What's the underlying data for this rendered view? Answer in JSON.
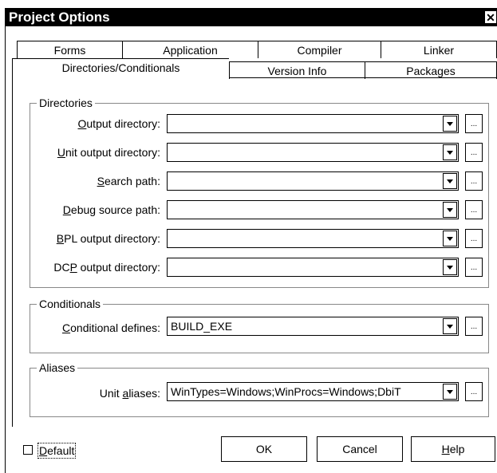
{
  "window": {
    "title": "Project Options",
    "close_label": "✕"
  },
  "tabs": {
    "row1": [
      "Forms",
      "Application",
      "Compiler",
      "Linker"
    ],
    "row2": [
      "Directories/Conditionals",
      "Version Info",
      "Packages"
    ],
    "active": "Directories/Conditionals"
  },
  "directories": {
    "legend": "Directories",
    "fields": [
      {
        "label_pre": "",
        "label_ul": "O",
        "label_post": "utput directory:",
        "value": ""
      },
      {
        "label_pre": "",
        "label_ul": "U",
        "label_post": "nit output directory:",
        "value": ""
      },
      {
        "label_pre": "",
        "label_ul": "S",
        "label_post": "earch path:",
        "value": ""
      },
      {
        "label_pre": "",
        "label_ul": "D",
        "label_post": "ebug source path:",
        "value": ""
      },
      {
        "label_pre": "",
        "label_ul": "B",
        "label_post": "PL output directory:",
        "value": ""
      },
      {
        "label_pre": "DC",
        "label_ul": "P",
        "label_post": " output directory:",
        "value": ""
      }
    ]
  },
  "conditionals": {
    "legend": "Conditionals",
    "label_pre": "",
    "label_ul": "C",
    "label_post": "onditional defines:",
    "value": "BUILD_EXE"
  },
  "aliases": {
    "legend": "Aliases",
    "label_pre": "Unit ",
    "label_ul": "a",
    "label_post": "liases:",
    "value": "WinTypes=Windows;WinProcs=Windows;DbiT"
  },
  "browse_label": "...",
  "footer": {
    "default_pre": "",
    "default_ul": "D",
    "default_post": "efault",
    "ok": "OK",
    "cancel": "Cancel",
    "help_pre": "",
    "help_ul": "H",
    "help_post": "elp"
  }
}
